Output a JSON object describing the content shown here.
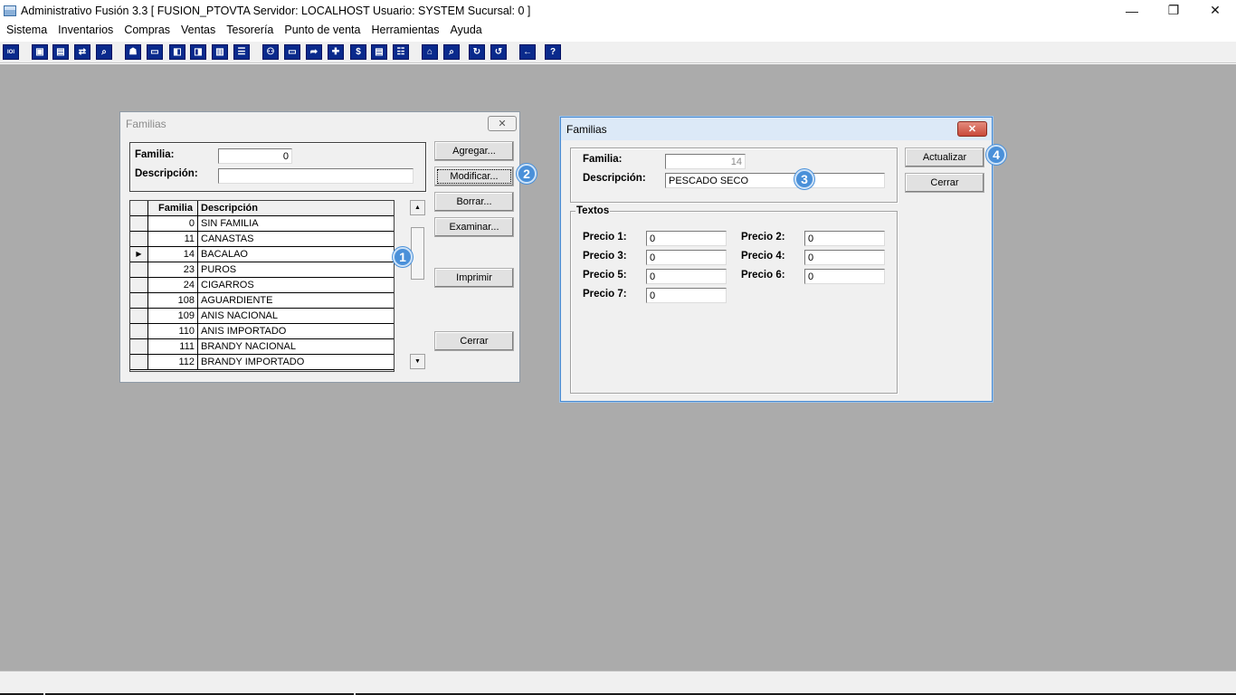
{
  "window": {
    "title": "Administrativo Fusión 3.3 [ FUSION_PTOVTA   Servidor: LOCALHOST   Usuario: SYSTEM     Sucursal: 0 ]",
    "minimize": "—",
    "restore": "❐",
    "close": "✕"
  },
  "menu": [
    "Sistema",
    "Inventarios",
    "Compras",
    "Ventas",
    "Tesorería",
    "Punto de venta",
    "Herramientas",
    "Ayuda"
  ],
  "toolbar": {
    "buttons": [
      {
        "icon": "ioi-icon",
        "glyph": "IOI"
      },
      {
        "icon": "window-icon",
        "glyph": "▣"
      },
      {
        "icon": "clipboard-icon",
        "glyph": "▤"
      },
      {
        "icon": "transfer-icon",
        "glyph": "⇄"
      },
      {
        "icon": "search-doc-icon",
        "glyph": "⌕"
      },
      {
        "icon": "user-icon",
        "glyph": "☗"
      },
      {
        "icon": "folder-icon",
        "glyph": "▭"
      },
      {
        "icon": "doc-in-icon",
        "glyph": "◧"
      },
      {
        "icon": "doc-out-icon",
        "glyph": "◨"
      },
      {
        "icon": "page-icon",
        "glyph": "▥"
      },
      {
        "icon": "list-icon",
        "glyph": "☰"
      },
      {
        "icon": "people-icon",
        "glyph": "⚇"
      },
      {
        "icon": "box-icon",
        "glyph": "▭"
      },
      {
        "icon": "doc-arrow-icon",
        "glyph": "➦"
      },
      {
        "icon": "plus-icon",
        "glyph": "✚"
      },
      {
        "icon": "dollar-icon",
        "glyph": "$"
      },
      {
        "icon": "report-icon",
        "glyph": "▤"
      },
      {
        "icon": "table-icon",
        "glyph": "☷"
      },
      {
        "icon": "home-icon",
        "glyph": "⌂"
      },
      {
        "icon": "zoom-icon",
        "glyph": "⌕"
      },
      {
        "icon": "refresh-icon",
        "glyph": "↻"
      },
      {
        "icon": "undo-icon",
        "glyph": "↺"
      },
      {
        "icon": "back-arrow-icon",
        "glyph": "←"
      },
      {
        "icon": "help-icon",
        "glyph": "?"
      }
    ]
  },
  "familias_list": {
    "title": "Familias",
    "close": "✕",
    "familia_label": "Familia:",
    "familia_value": "0",
    "descripcion_label": "Descripción:",
    "descripcion_value": "",
    "columns": {
      "familia": "Familia",
      "descripcion": "Descripción"
    },
    "selected_indicator": "▶",
    "rows": [
      {
        "familia": "0",
        "descripcion": "SIN FAMILIA"
      },
      {
        "familia": "11",
        "descripcion": "CANASTAS"
      },
      {
        "familia": "14",
        "descripcion": "BACALAO"
      },
      {
        "familia": "23",
        "descripcion": "PUROS"
      },
      {
        "familia": "24",
        "descripcion": "CIGARROS"
      },
      {
        "familia": "108",
        "descripcion": "AGUARDIENTE"
      },
      {
        "familia": "109",
        "descripcion": "ANIS NACIONAL"
      },
      {
        "familia": "110",
        "descripcion": "ANIS IMPORTADO"
      },
      {
        "familia": "111",
        "descripcion": "BRANDY NACIONAL"
      },
      {
        "familia": "112",
        "descripcion": "BRANDY IMPORTADO"
      }
    ],
    "selected_row": 2,
    "scroll_up": "▲",
    "scroll_down": "▼",
    "buttons": {
      "agregar": "Agregar...",
      "modificar": "Modificar...",
      "borrar": "Borrar...",
      "examinar": "Examinar...",
      "imprimir": "Imprimir",
      "cerrar": "Cerrar"
    }
  },
  "familias_edit": {
    "title": "Familias",
    "close": "✕",
    "familia_label": "Familia:",
    "familia_value": "14",
    "descripcion_label": "Descripción:",
    "descripcion_value": "PESCADO SECO",
    "group_title": "Textos",
    "precios": [
      {
        "label": "Precio 1:",
        "value": "0"
      },
      {
        "label": "Precio 2:",
        "value": "0"
      },
      {
        "label": "Precio 3:",
        "value": "0"
      },
      {
        "label": "Precio 4:",
        "value": "0"
      },
      {
        "label": "Precio 5:",
        "value": "0"
      },
      {
        "label": "Precio 6:",
        "value": "0"
      },
      {
        "label": "Precio 7:",
        "value": "0"
      }
    ],
    "buttons": {
      "actualizar": "Actualizar",
      "cerrar": "Cerrar"
    }
  },
  "badges": [
    "1",
    "2",
    "3",
    "4"
  ],
  "colors": {
    "desktop": "#ababab",
    "toolbar_icon": "#0a2a8c",
    "badge": "#4a90d9",
    "close_red": "#c94a3a"
  }
}
